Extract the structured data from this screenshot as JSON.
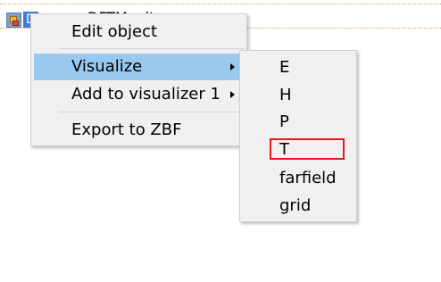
{
  "tree": {
    "selected_label": "D",
    "node_label": "DFTMonitor"
  },
  "context_menu": {
    "items": [
      {
        "label": "Edit object"
      },
      {
        "label": "Visualize"
      },
      {
        "label": "Add to visualizer 1"
      },
      {
        "label": "Export to ZBF"
      }
    ]
  },
  "submenu": {
    "items": [
      {
        "label": "E"
      },
      {
        "label": "H"
      },
      {
        "label": "P"
      },
      {
        "label": "T"
      },
      {
        "label": "farfield"
      },
      {
        "label": "grid"
      }
    ]
  },
  "colors": {
    "menu_bg": "#f0f0f0",
    "highlight": "#99c9ef",
    "annotation_box": "#e01c1c"
  }
}
